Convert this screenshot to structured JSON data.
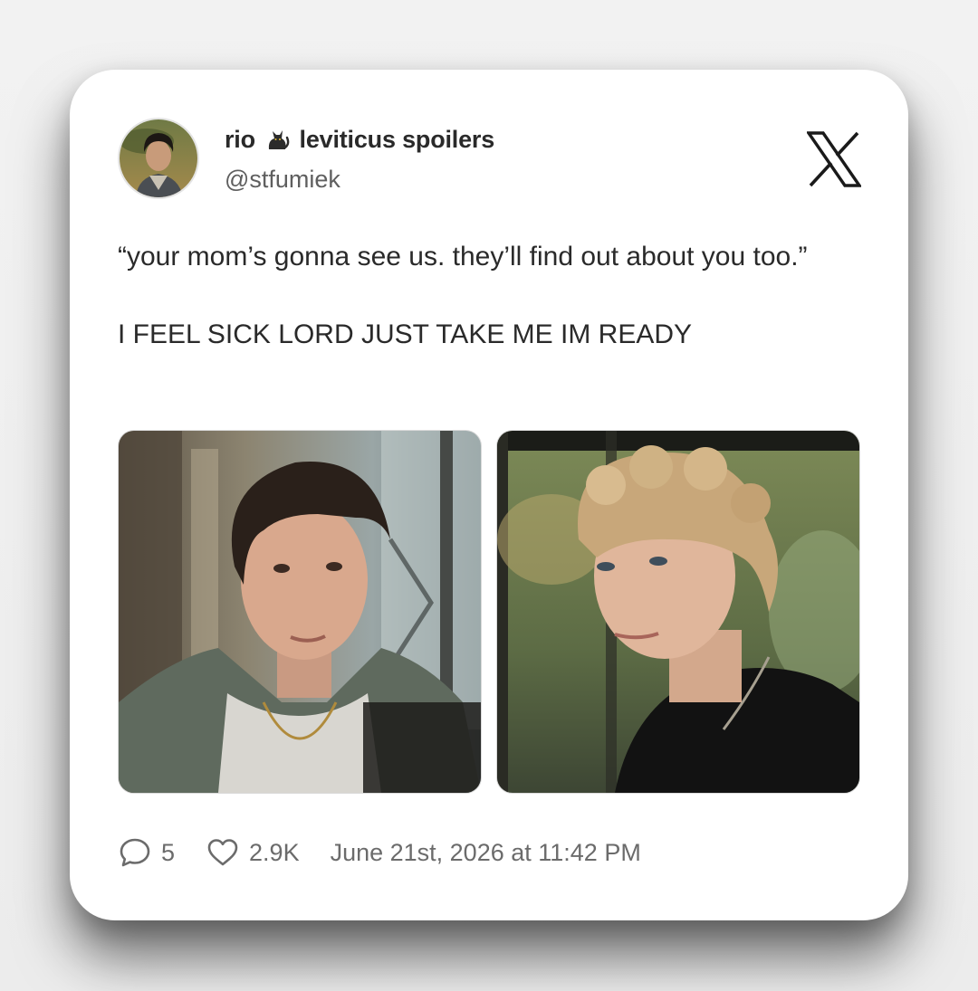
{
  "author": {
    "name_part1": "rio",
    "name_emoji": "black-cat",
    "name_part2": "leviticus spoilers",
    "handle": "@stfumiek"
  },
  "tweet": {
    "line1": "“your mom’s gonna see us. they’ll find out about you too.”",
    "line2": "I FEEL SICK LORD JUST TAKE ME IM READY"
  },
  "media": [
    {
      "description_icon": "photo-dark-haired-young-man"
    },
    {
      "description_icon": "photo-blond-curly-haired-young-man"
    }
  ],
  "stats": {
    "replies": "5",
    "likes": "2.9K",
    "timestamp": "June 21st, 2026 at 11:42 PM"
  },
  "icons": {
    "reply": "comment-bubble-icon",
    "like": "heart-icon",
    "brand": "x-logo-icon"
  },
  "colors": {
    "text": "#2a2a2a",
    "muted": "#6b6b6b",
    "card": "#ffffff",
    "background": "#f0f0f0"
  }
}
